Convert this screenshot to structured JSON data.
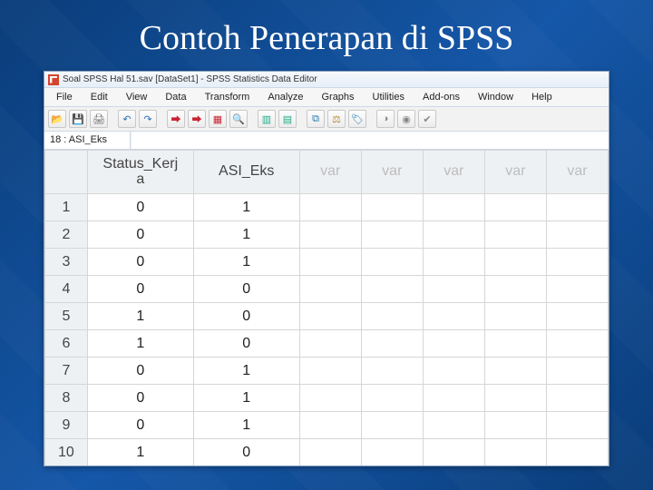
{
  "slide": {
    "title": "Contoh Penerapan di SPSS"
  },
  "window": {
    "title": "Soal SPSS Hal 51.sav [DataSet1] - SPSS Statistics Data Editor"
  },
  "menu": {
    "items": [
      "File",
      "Edit",
      "View",
      "Data",
      "Transform",
      "Analyze",
      "Graphs",
      "Utilities",
      "Add-ons",
      "Window",
      "Help"
    ]
  },
  "toolbar": {
    "icons": [
      "open-icon",
      "save-icon",
      "print-icon",
      "undo-icon",
      "redo-icon",
      "goto-icon",
      "goto-var-icon",
      "select-cases-icon",
      "weight-icon",
      "find-icon",
      "insert-var-icon",
      "insert-case-icon",
      "split-icon",
      "value-labels-icon",
      "variables-icon",
      "run-icon",
      "chart-icon",
      "sets-icon",
      "show-icon"
    ]
  },
  "cellref": {
    "label": "18 : ASI_Eks",
    "value": ""
  },
  "grid": {
    "columns": [
      "Status_Kerja",
      "ASI_Eks"
    ],
    "varcols": [
      "var",
      "var",
      "var",
      "var",
      "var"
    ],
    "rows": [
      {
        "n": "1",
        "v": [
          "0",
          "1"
        ]
      },
      {
        "n": "2",
        "v": [
          "0",
          "1"
        ]
      },
      {
        "n": "3",
        "v": [
          "0",
          "1"
        ]
      },
      {
        "n": "4",
        "v": [
          "0",
          "0"
        ]
      },
      {
        "n": "5",
        "v": [
          "1",
          "0"
        ]
      },
      {
        "n": "6",
        "v": [
          "1",
          "0"
        ]
      },
      {
        "n": "7",
        "v": [
          "0",
          "1"
        ]
      },
      {
        "n": "8",
        "v": [
          "0",
          "1"
        ]
      },
      {
        "n": "9",
        "v": [
          "0",
          "1"
        ]
      },
      {
        "n": "10",
        "v": [
          "1",
          "0"
        ]
      }
    ]
  }
}
